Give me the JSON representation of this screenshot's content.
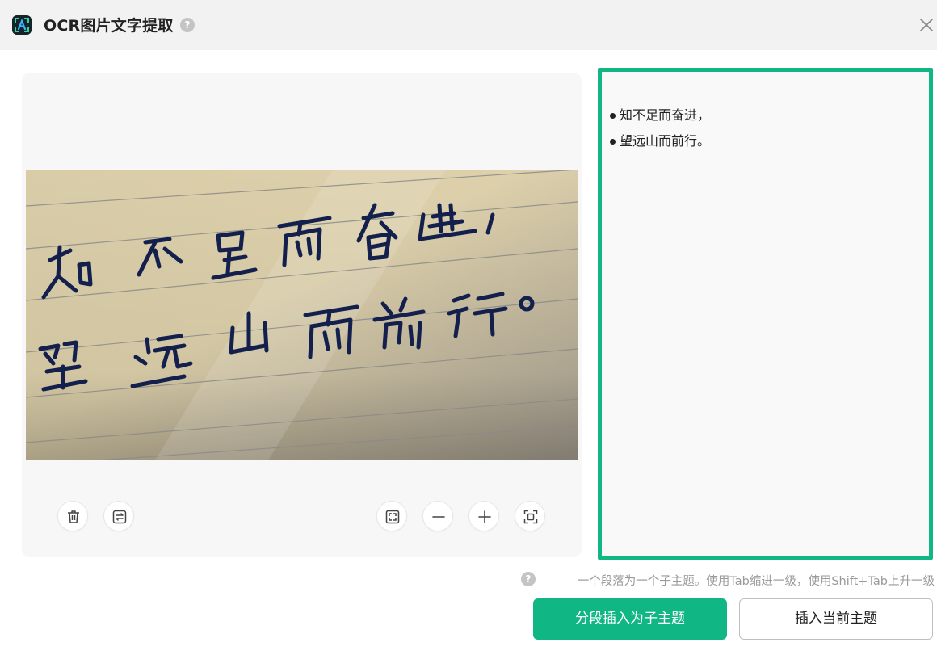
{
  "dialog": {
    "title": "OCR图片文字提取",
    "help_symbol": "?",
    "close_icon": "close-icon",
    "logo_icon": "ocr-app-icon"
  },
  "image_panel": {
    "photo": "handwritten-note-photo",
    "controls": {
      "left": [
        "trash-icon",
        "swap-icon"
      ],
      "right": [
        "fit-screen-icon",
        "zoom-out-icon",
        "zoom-in-icon",
        "scan-icon"
      ]
    }
  },
  "result": {
    "lines": [
      "知不足而奋进，",
      "望远山而前行。"
    ]
  },
  "hint": {
    "symbol": "?",
    "text": "一个段落为一个子主题。使用Tab缩进一级，使用Shift+Tab上升一级"
  },
  "buttons": {
    "insert_as_subtopics": "分段插入为子主题",
    "insert_current_topic": "插入当前主题"
  },
  "colors": {
    "accent": "#10b784",
    "titlebar": "#f2f2f2",
    "panel": "#f7f7f8",
    "ink": "#0f1f4a",
    "paper": "#d7c9a4"
  }
}
